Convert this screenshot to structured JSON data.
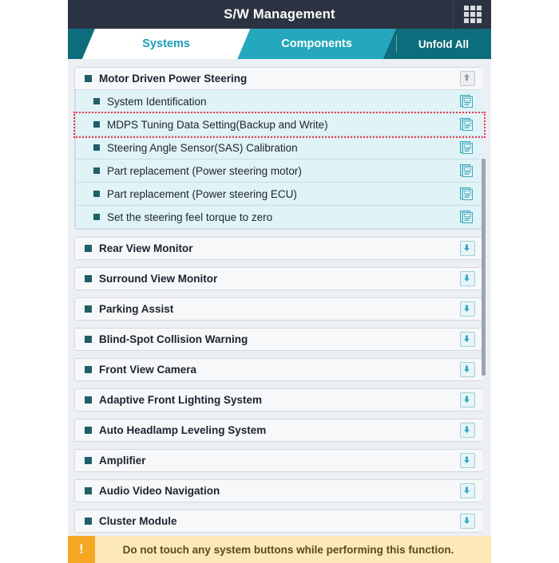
{
  "titlebar": {
    "title": "S/W Management",
    "grid_icon": "grid-menu-icon"
  },
  "tabs": [
    {
      "label": "Systems",
      "active": true
    },
    {
      "label": "Components",
      "active": false
    }
  ],
  "toolbar": {
    "unfold_all_label": "Unfold All"
  },
  "colors": {
    "titlebar_bg": "#2b3342",
    "tab_active_bg": "#ffffff",
    "tab_active_text": "#1b9dba",
    "tab_inactive_bg": "#25a8bd",
    "tabbar_bg": "#0d6d7c",
    "list_bg": "#eceff3",
    "row_head_bg": "#f7f8f9",
    "row_sub_bg": "#e0f3f6",
    "bullet": "#1e5f68",
    "highlight_border": "#f1334b",
    "banner_bg": "#fde9b8",
    "banner_icon_bg": "#f5a623"
  },
  "groups": [
    {
      "label": "Motor Driven Power Steering",
      "expanded": true,
      "icon": "collapse-up-icon",
      "items": [
        {
          "label": "System Identification",
          "icon": "documents-icon",
          "highlighted": false
        },
        {
          "label": "MDPS Tuning Data Setting(Backup and Write)",
          "icon": "documents-icon",
          "highlighted": true
        },
        {
          "label": "Steering Angle Sensor(SAS) Calibration",
          "icon": "documents-icon",
          "highlighted": false
        },
        {
          "label": "Part replacement (Power steering motor)",
          "icon": "documents-icon",
          "highlighted": false
        },
        {
          "label": "Part replacement (Power steering ECU)",
          "icon": "documents-icon",
          "highlighted": false
        },
        {
          "label": "Set the steering feel torque to zero",
          "icon": "documents-icon",
          "highlighted": false
        }
      ]
    },
    {
      "label": "Rear View Monitor",
      "expanded": false,
      "icon": "expand-down-icon",
      "items": []
    },
    {
      "label": "Surround View Monitor",
      "expanded": false,
      "icon": "expand-down-icon",
      "items": []
    },
    {
      "label": "Parking Assist",
      "expanded": false,
      "icon": "expand-down-icon",
      "items": []
    },
    {
      "label": "Blind-Spot Collision Warning",
      "expanded": false,
      "icon": "expand-down-icon",
      "items": []
    },
    {
      "label": "Front View Camera",
      "expanded": false,
      "icon": "expand-down-icon",
      "items": []
    },
    {
      "label": "Adaptive Front Lighting System",
      "expanded": false,
      "icon": "expand-down-icon",
      "items": []
    },
    {
      "label": "Auto Headlamp Leveling System",
      "expanded": false,
      "icon": "expand-down-icon",
      "items": []
    },
    {
      "label": "Amplifier",
      "expanded": false,
      "icon": "expand-down-icon",
      "items": []
    },
    {
      "label": "Audio Video Navigation",
      "expanded": false,
      "icon": "expand-down-icon",
      "items": []
    },
    {
      "label": "Cluster Module",
      "expanded": false,
      "icon": "expand-down-icon",
      "items": []
    }
  ],
  "banner": {
    "icon": "warning-exclamation-icon",
    "icon_glyph": "!",
    "message": "Do not touch any system buttons while performing this function."
  }
}
